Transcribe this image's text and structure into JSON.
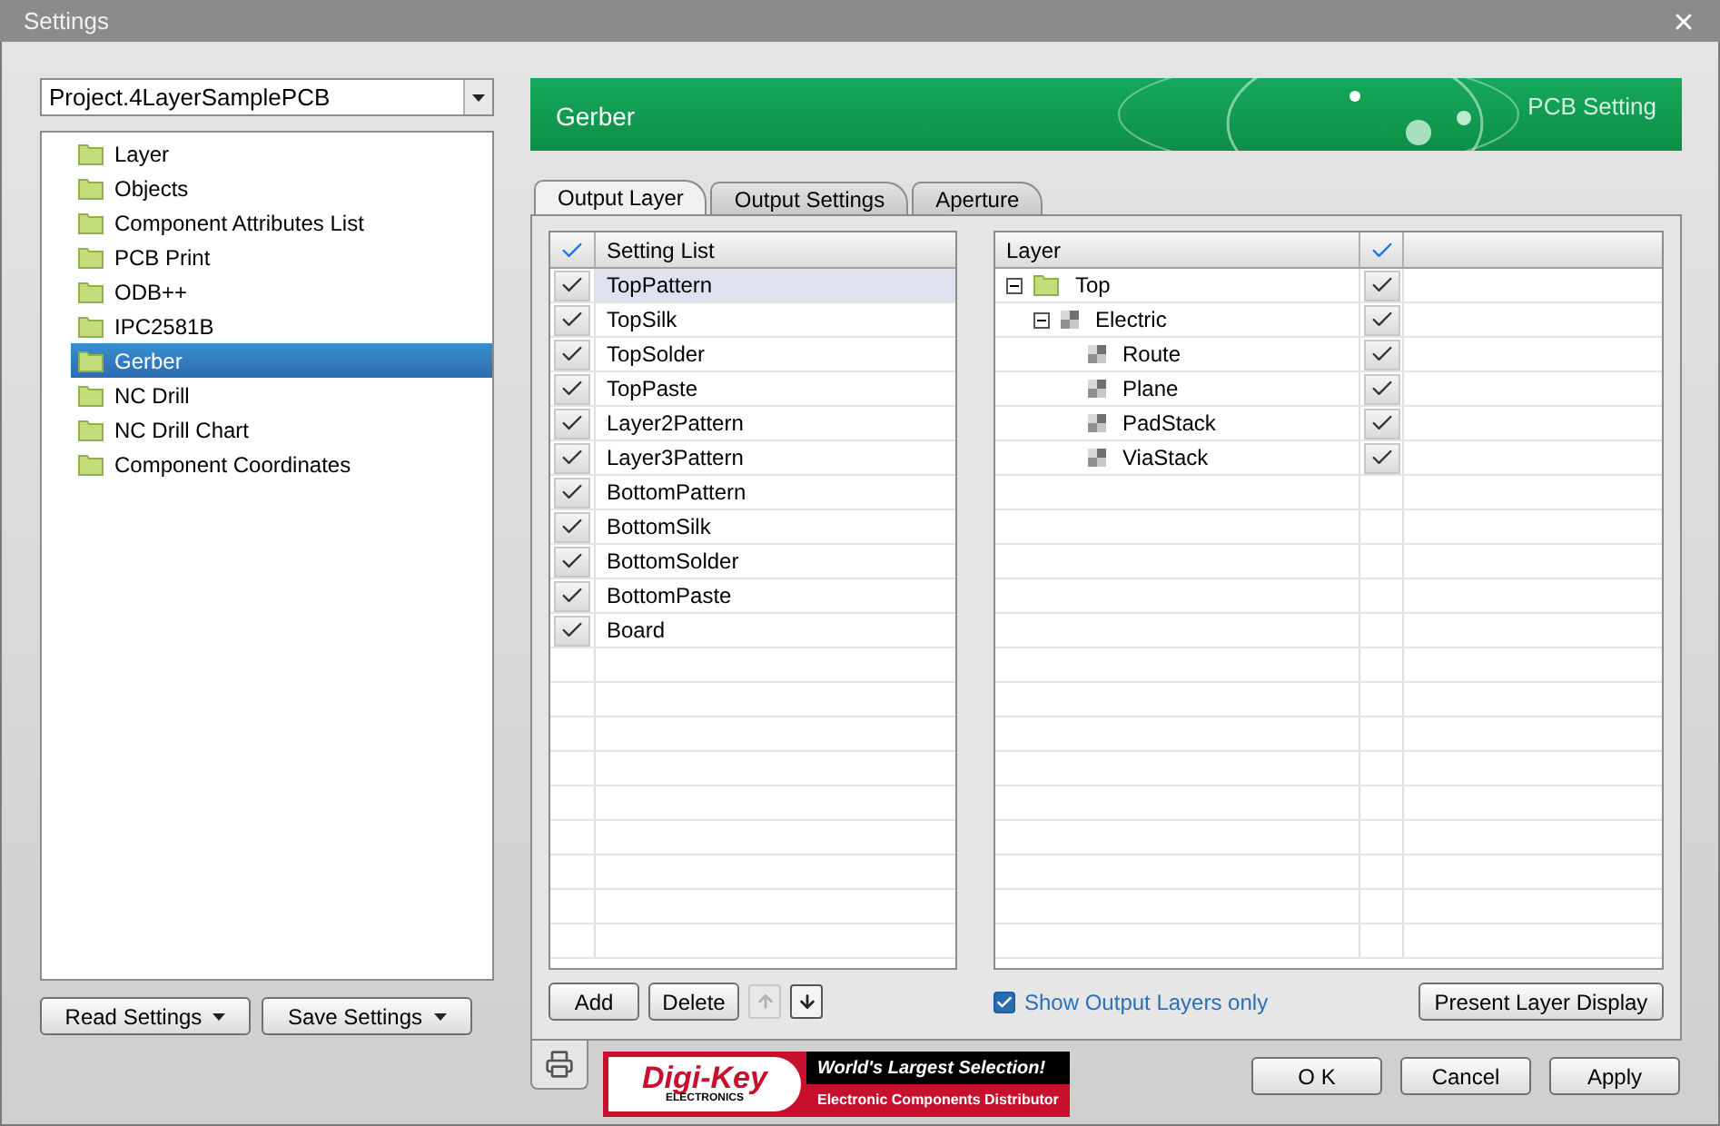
{
  "window": {
    "title": "Settings"
  },
  "project_select": {
    "value": "Project.4LayerSamplePCB"
  },
  "sidebar": {
    "items": [
      {
        "label": "Layer",
        "selected": false
      },
      {
        "label": "Objects",
        "selected": false
      },
      {
        "label": "Component Attributes List",
        "selected": false
      },
      {
        "label": "PCB Print",
        "selected": false
      },
      {
        "label": "ODB++",
        "selected": false
      },
      {
        "label": "IPC2581B",
        "selected": false
      },
      {
        "label": "Gerber",
        "selected": true
      },
      {
        "label": "NC Drill",
        "selected": false
      },
      {
        "label": "NC Drill Chart",
        "selected": false
      },
      {
        "label": "Component Coordinates",
        "selected": false
      }
    ]
  },
  "sidebar_buttons": [
    "Read Settings",
    "Save Settings"
  ],
  "header": {
    "title": "Gerber",
    "subtitle": "PCB Setting"
  },
  "tabs": [
    {
      "label": "Output Layer",
      "selected": true
    },
    {
      "label": "Output Settings",
      "selected": false
    },
    {
      "label": "Aperture",
      "selected": false
    }
  ],
  "setting_list": {
    "column": "Setting List",
    "header_checked": true,
    "rows": [
      {
        "label": "TopPattern",
        "checked": true,
        "selected": true
      },
      {
        "label": "TopSilk",
        "checked": true,
        "selected": false
      },
      {
        "label": "TopSolder",
        "checked": true,
        "selected": false
      },
      {
        "label": "TopPaste",
        "checked": true,
        "selected": false
      },
      {
        "label": "Layer2Pattern",
        "checked": true,
        "selected": false
      },
      {
        "label": "Layer3Pattern",
        "checked": true,
        "selected": false
      },
      {
        "label": "BottomPattern",
        "checked": true,
        "selected": false
      },
      {
        "label": "BottomSilk",
        "checked": true,
        "selected": false
      },
      {
        "label": "BottomSolder",
        "checked": true,
        "selected": false
      },
      {
        "label": "BottomPaste",
        "checked": true,
        "selected": false
      },
      {
        "label": "Board",
        "checked": true,
        "selected": false
      }
    ]
  },
  "layer_tree": {
    "column": "Layer",
    "header_checked": true,
    "items": [
      {
        "label": "Top",
        "kind": "folder",
        "expanded": true,
        "checked": true,
        "children": [
          {
            "label": "Electric",
            "kind": "layer",
            "expanded": true,
            "checked": true,
            "children": [
              {
                "label": "Route",
                "kind": "layer",
                "checked": true
              },
              {
                "label": "Plane",
                "kind": "layer",
                "checked": true
              },
              {
                "label": "PadStack",
                "kind": "layer",
                "checked": true
              },
              {
                "label": "ViaStack",
                "kind": "layer",
                "checked": true
              }
            ]
          }
        ]
      }
    ]
  },
  "list_buttons": {
    "add": "Add",
    "delete": "Delete",
    "up_disabled": true,
    "down_disabled": false
  },
  "show_output_only": {
    "label": "Show Output Layers only",
    "checked": true
  },
  "present_button": "Present Layer Display",
  "ad": {
    "brand": "Digi-Key",
    "sub": "ELECTRONICS",
    "headline": "World's Largest Selection!",
    "tagline": "Electronic Components Distributor"
  },
  "dialog_buttons": [
    "O K",
    "Cancel",
    "Apply"
  ]
}
